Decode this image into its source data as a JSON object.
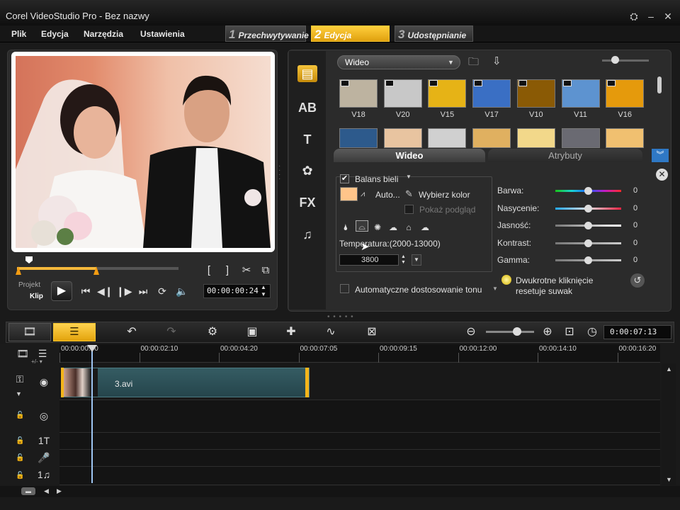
{
  "window": {
    "title": "Corel VideoStudio Pro - Bez nazwy",
    "buttons": [
      "⛭",
      "–",
      "✕"
    ]
  },
  "menu": [
    "Plik",
    "Edycja",
    "Narzędzia",
    "Ustawienia"
  ],
  "steps": [
    {
      "num": "1",
      "label": "Przechwytywanie"
    },
    {
      "num": "2",
      "label": "Edycja"
    },
    {
      "num": "3",
      "label": "Udostępnianie"
    }
  ],
  "preview": {
    "label_project": "Projekt",
    "label_clip": "Klip",
    "timecode": "00:00:00:24",
    "scrub_progress": 0.5
  },
  "library": {
    "dropdown": "Wideo",
    "thumbnails_row1": [
      "V18",
      "V20",
      "V15",
      "V17",
      "V10",
      "V11",
      "V16"
    ],
    "colors": {
      "V18": "#bdb3a0",
      "V20": "#c8c8c8",
      "V15": "#e6b316",
      "V17": "#3a6fc4",
      "V10": "#8a5a05",
      "V11": "#5d93d0",
      "V16": "#e59a0c"
    },
    "row2_colors": [
      "#2d5a8c",
      "#e8c4a0",
      "#d0d0d0",
      "#e0b060",
      "#f2d88a",
      "#6a6a72",
      "#f0c070"
    ]
  },
  "options": {
    "tab_video": "Wideo",
    "tab_attributes": "Atrybuty",
    "white_balance": {
      "label": "Balans bieli",
      "checked": true,
      "auto": "Auto...",
      "pick_color": "Wybierz kolor",
      "show_preview": "Pokaż podgląd",
      "temp_label": "Temperatura:(2000-13000)",
      "temp_value": "3800"
    },
    "auto_tone": "Automatyczne dostosowanie tonu",
    "hint": "Dwukrotne kliknięcie resetuje suwak",
    "hint_line1": "Dwukrotne kliknięcie",
    "hint_line2": "resetuje suwak",
    "sliders": [
      {
        "label": "Barwa:",
        "value": "0"
      },
      {
        "label": "Nasycenie:",
        "value": "0"
      },
      {
        "label": "Jasność:",
        "value": "0"
      },
      {
        "label": "Kontrast:",
        "value": "0"
      },
      {
        "label": "Gamma:",
        "value": "0"
      }
    ]
  },
  "timeline": {
    "timecode": "0:00:07:13",
    "ruler": [
      "00:00:00:00",
      "00:00:02:10",
      "00:00:04:20",
      "00:00:07:05",
      "00:00:09:15",
      "00:00:12:00",
      "00:00:14:10",
      "00:00:16:20"
    ],
    "clip_name": "3.avi"
  },
  "accent": "#f4b51a"
}
